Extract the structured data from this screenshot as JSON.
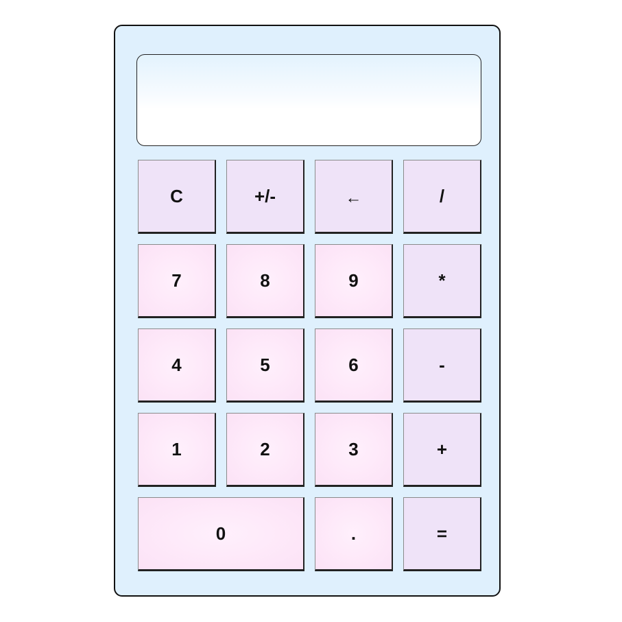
{
  "display": {
    "value": ""
  },
  "keys": {
    "clear": "C",
    "negate": "+/-",
    "backspace": "←",
    "divide": "/",
    "seven": "7",
    "eight": "8",
    "nine": "9",
    "multiply": "*",
    "four": "4",
    "five": "5",
    "six": "6",
    "subtract": "-",
    "one": "1",
    "two": "2",
    "three": "3",
    "add": "+",
    "zero": "0",
    "decimal": ".",
    "equals": "="
  },
  "colors": {
    "body": "#dff0fd",
    "number_key": "#fde6f8",
    "operator_key": "#efe3f8",
    "border": "#111111"
  }
}
